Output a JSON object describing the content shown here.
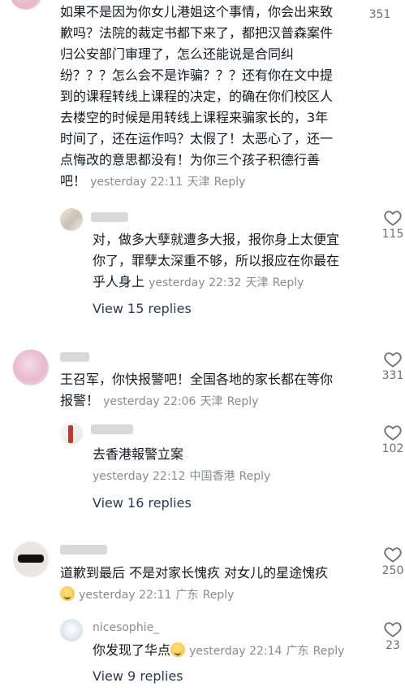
{
  "comments": [
    {
      "text_lines": [
        "如果不是因为你女儿港姐这个事情，你会出来致",
        "歉吗？法院的裁定书都下来了，都把汉普森案件",
        "归公安部门审理了，怎么还能说是合同纠",
        "纷？？？怎么会不是诈骗？？？还有你在文中提",
        "到的课程转线上课程的决定，的确在你们校区人",
        "去楼空的时候是用转线上课程来骗家长的，3年",
        "时间了，还在运作吗？太假了！太恶心了，还一",
        "点悔改的意思都没有！为你三个孩子积德行善"
      ],
      "last_line": "吧！",
      "timestamp": "yesterday 22:11",
      "location": "天津",
      "reply_label": "Reply",
      "likes": "351"
    },
    {
      "reply_text_lines": [
        "对，做多大孽就遭多大报，报你身上太便宜",
        "你了，罪孽太深重不够，所以报应在你最在"
      ],
      "reply_last_line": "乎人身上",
      "reply_timestamp": "yesterday 22:32",
      "reply_location": "天津",
      "reply_label": "Reply",
      "reply_likes": "115",
      "view_replies": "View 15 replies"
    },
    {
      "text_lines": [
        "王召军，你快报警吧！全国各地的家长都在等你"
      ],
      "last_line": "报警！",
      "timestamp": "yesterday 22:06",
      "location": "天津",
      "reply_label": "Reply",
      "likes": "331",
      "reply_text": "去香港報警立案",
      "reply_timestamp": "yesterday 22:12",
      "reply_location": "中国香港",
      "reply_likes": "102",
      "view_replies": "View 16 replies"
    },
    {
      "text": "道歉到最后 不是对家长愧疚 对女儿的星途愧疚",
      "timestamp": "yesterday 22:11",
      "location": "广东",
      "reply_label": "Reply",
      "likes": "250",
      "reply_username": "nicesophie_",
      "reply_text": "你发现了华点",
      "reply_timestamp": "yesterday 22:14",
      "reply_location": "广东",
      "reply_likes": "23",
      "view_replies": "View 9 replies"
    }
  ],
  "icons": {
    "like": "heart-outline-icon",
    "emoji": "grinning-face-emoji"
  },
  "colors": {
    "text": "#161823",
    "meta": "#8a8b91",
    "link": "#2b3a55"
  }
}
